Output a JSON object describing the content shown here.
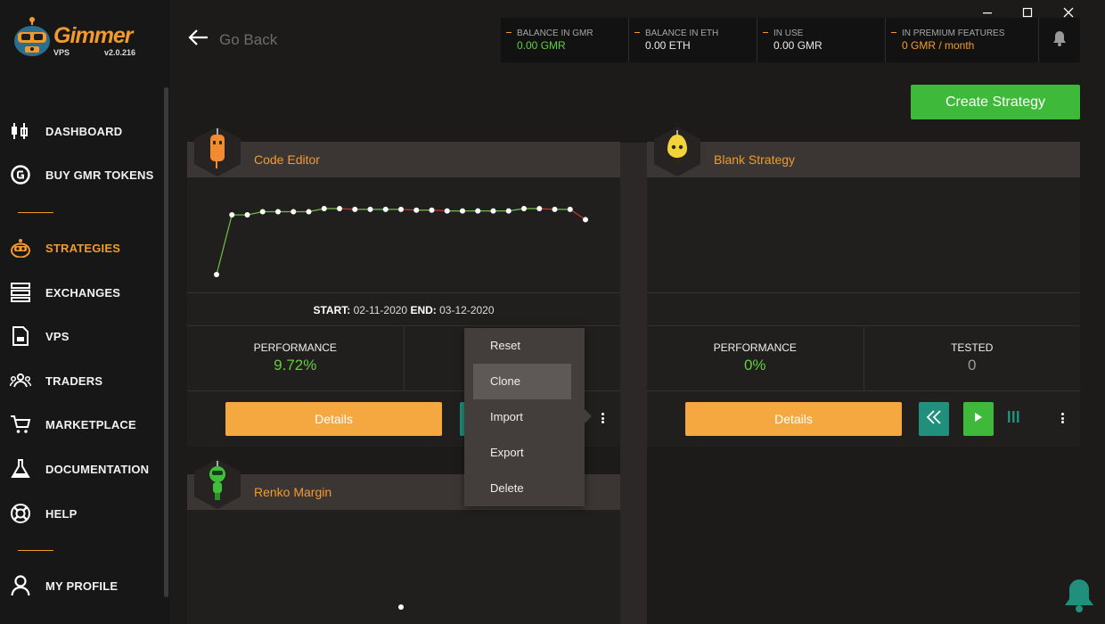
{
  "app": {
    "name": "Gimmer",
    "sub": "VPS",
    "version": "v2.0.216"
  },
  "nav": [
    {
      "label": "DASHBOARD",
      "icon": "candlestick-icon",
      "name": "nav-dashboard"
    },
    {
      "label": "BUY GMR TOKENS",
      "icon": "gmr-token-icon",
      "name": "nav-buy-gmr-tokens"
    },
    {
      "label": "STRATEGIES",
      "icon": "robot-icon",
      "name": "nav-strategies",
      "active": true
    },
    {
      "label": "EXCHANGES",
      "icon": "server-icon",
      "name": "nav-exchanges"
    },
    {
      "label": "VPS",
      "icon": "sd-card-icon",
      "name": "nav-vps"
    },
    {
      "label": "TRADERS",
      "icon": "users-icon",
      "name": "nav-traders"
    },
    {
      "label": "MARKETPLACE",
      "icon": "cart-icon",
      "name": "nav-marketplace"
    },
    {
      "label": "DOCUMENTATION",
      "icon": "flask-icon",
      "name": "nav-documentation"
    },
    {
      "label": "HELP",
      "icon": "lifebuoy-icon",
      "name": "nav-help"
    },
    {
      "label": "MY PROFILE",
      "icon": "user-icon",
      "name": "nav-my-profile"
    }
  ],
  "header": {
    "back_label": "Go Back",
    "balances": [
      {
        "title": "BALANCE IN GMR",
        "value": "0.00 GMR",
        "color": "#5fcf3c"
      },
      {
        "title": "BALANCE IN ETH",
        "value": "0.00 ETH",
        "color": "#eaeaea"
      },
      {
        "title": "IN USE",
        "value": "0.00 GMR",
        "color": "#eaeaea"
      },
      {
        "title": "IN PREMIUM FEATURES",
        "value": "0 GMR / month",
        "color": "#f29a2e"
      }
    ]
  },
  "create_button": "Create Strategy",
  "cards": [
    {
      "title": "Code Editor",
      "avatar": "orange-robot-icon",
      "start_label": "START:",
      "start": "02-11-2020",
      "end_label": "END:",
      "end": "03-12-2020",
      "performance_label": "PERFORMANCE",
      "performance": "9.72%",
      "details_label": "Details"
    },
    {
      "title": "Blank Strategy",
      "avatar": "yellow-robot-icon",
      "performance_label": "PERFORMANCE",
      "performance": "0%",
      "tested_label": "TESTED",
      "tested": "0",
      "details_label": "Details"
    },
    {
      "title": "Renko Margin",
      "avatar": "green-robot-icon"
    }
  ],
  "context_menu": [
    "Reset",
    "Clone",
    "Import",
    "Export",
    "Delete"
  ],
  "chart_data": {
    "type": "line",
    "x": [
      1,
      2,
      3,
      4,
      5,
      6,
      7,
      8,
      9,
      10,
      11,
      12,
      13,
      14,
      15,
      16,
      17,
      18,
      19,
      20,
      21,
      22,
      23,
      24,
      25
    ],
    "values": [
      0,
      7.6,
      7.6,
      8.0,
      8.0,
      8.0,
      8.0,
      8.4,
      8.4,
      8.3,
      8.3,
      8.3,
      8.3,
      8.2,
      8.2,
      8.1,
      8.1,
      8.1,
      8.1,
      8.1,
      8.4,
      8.4,
      8.3,
      8.3,
      7.0
    ],
    "xlabel": "",
    "ylabel": "",
    "grid": false,
    "colors": {
      "up": "#6cc04a",
      "down": "#c0392b",
      "point": "#ffffff"
    }
  },
  "colors": {
    "accent": "#f29a2e",
    "green": "#3fb93a",
    "teal": "#20907c",
    "details": "#f5a840"
  }
}
